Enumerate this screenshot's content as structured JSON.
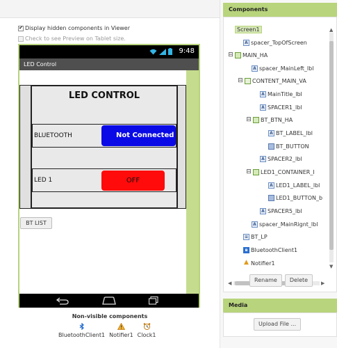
{
  "viewer": {
    "display_hidden_label": "Display hidden components in Viewer",
    "tablet_preview_label": "Check to see Preview on Tablet size.",
    "display_hidden_checked": true,
    "tablet_preview_checked": false,
    "status_time": "9:48",
    "screen_title": "LED Control",
    "main_title": "LED CONTROL",
    "bt_label": "BLUETOOTH",
    "bt_button": "Not Connected",
    "led1_label": "LED 1",
    "led1_button": "OFF",
    "bt_list_button": "BT LIST",
    "nonvisible_title": "Non-visible components",
    "nonvisible_items": [
      "BluetoothClient1",
      "Notifier1",
      "Clock1"
    ]
  },
  "colors": {
    "accent_green": "#b8d47c",
    "bt_button_bg": "#0a0ae6",
    "led_button_bg": "#ff0b0b"
  },
  "components": {
    "header": "Components",
    "tree": [
      {
        "name": "Screen1",
        "icon": "screen-icon",
        "toggle": "",
        "selected": true
      },
      {
        "name": "spacer_TopOfScreen",
        "icon": "label-icon",
        "toggle": ""
      },
      {
        "name": "MAIN_HA",
        "icon": "horizontal-arrangement-icon",
        "toggle": "⊟"
      },
      {
        "name": "spacer_MainLeft_lbl",
        "icon": "label-icon",
        "toggle": ""
      },
      {
        "name": "CONTENT_MAIN_VA",
        "icon": "vertical-arrangement-icon",
        "toggle": "⊟"
      },
      {
        "name": "MainTitle_lbl",
        "icon": "label-icon",
        "toggle": ""
      },
      {
        "name": "SPACER1_lbl",
        "icon": "label-icon",
        "toggle": ""
      },
      {
        "name": "BT_BTN_HA",
        "icon": "horizontal-arrangement-icon",
        "toggle": "⊟"
      },
      {
        "name": "BT_LABEL_lbl",
        "icon": "label-icon",
        "toggle": ""
      },
      {
        "name": "BT_BUTTON",
        "icon": "button-icon",
        "toggle": ""
      },
      {
        "name": "SPACER2_lbl",
        "icon": "label-icon",
        "toggle": ""
      },
      {
        "name": "LED1_CONTAINER_I",
        "icon": "horizontal-arrangement-icon",
        "toggle": "⊟"
      },
      {
        "name": "LED1_LABEL_lbl",
        "icon": "label-icon",
        "toggle": ""
      },
      {
        "name": "LED1_BUTTON_b",
        "icon": "button-icon",
        "toggle": ""
      },
      {
        "name": "SPACER5_lbl",
        "icon": "label-icon",
        "toggle": ""
      },
      {
        "name": "spacer_MainRignt_lbl",
        "icon": "label-icon",
        "toggle": ""
      },
      {
        "name": "BT_LP",
        "icon": "listpicker-icon",
        "toggle": ""
      },
      {
        "name": "BluetoothClient1",
        "icon": "bluetooth-icon",
        "toggle": ""
      },
      {
        "name": "Notifier1",
        "icon": "warning-icon",
        "toggle": ""
      }
    ],
    "rename_button": "Rename",
    "delete_button": "Delete"
  },
  "media": {
    "header": "Media",
    "upload_button": "Upload File ..."
  }
}
